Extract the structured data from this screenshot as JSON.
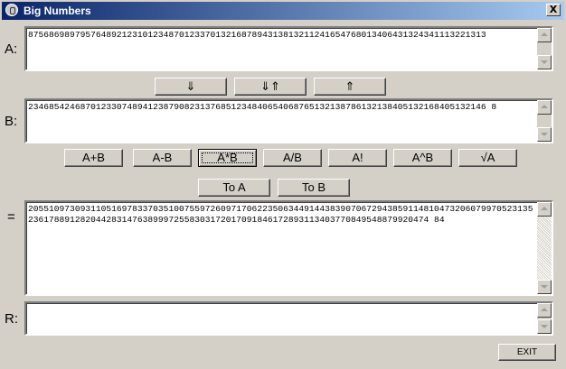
{
  "window": {
    "title": "Big Numbers",
    "close_glyph": "X"
  },
  "labels": {
    "a": "A:",
    "b": "B:",
    "result": "=",
    "r": "R:"
  },
  "fields": {
    "a_value": "8756869897957648921231012348701233701321687894313813211241654768013406431324341113221313",
    "b_value": "2346854246870123307489412387908231376851234840654068765132138786132138405132168405132146 8",
    "result_value": "205510973093110516978337035100755972609717062235063449144383907067294385911481047320607997052313523617889128204428314763899972558303172017091846172893113403770849548879920474 84",
    "r_value": ""
  },
  "swap_buttons": {
    "copy_down": "⇓",
    "swap": "⇓⇑",
    "copy_up": "⇑"
  },
  "op_buttons": [
    "A+B",
    "A-B",
    "A*B",
    "A/B",
    "A!",
    "A^B",
    "√A"
  ],
  "assign_buttons": {
    "to_a": "To A",
    "to_b": "To B"
  },
  "exit_label": "EXIT"
}
